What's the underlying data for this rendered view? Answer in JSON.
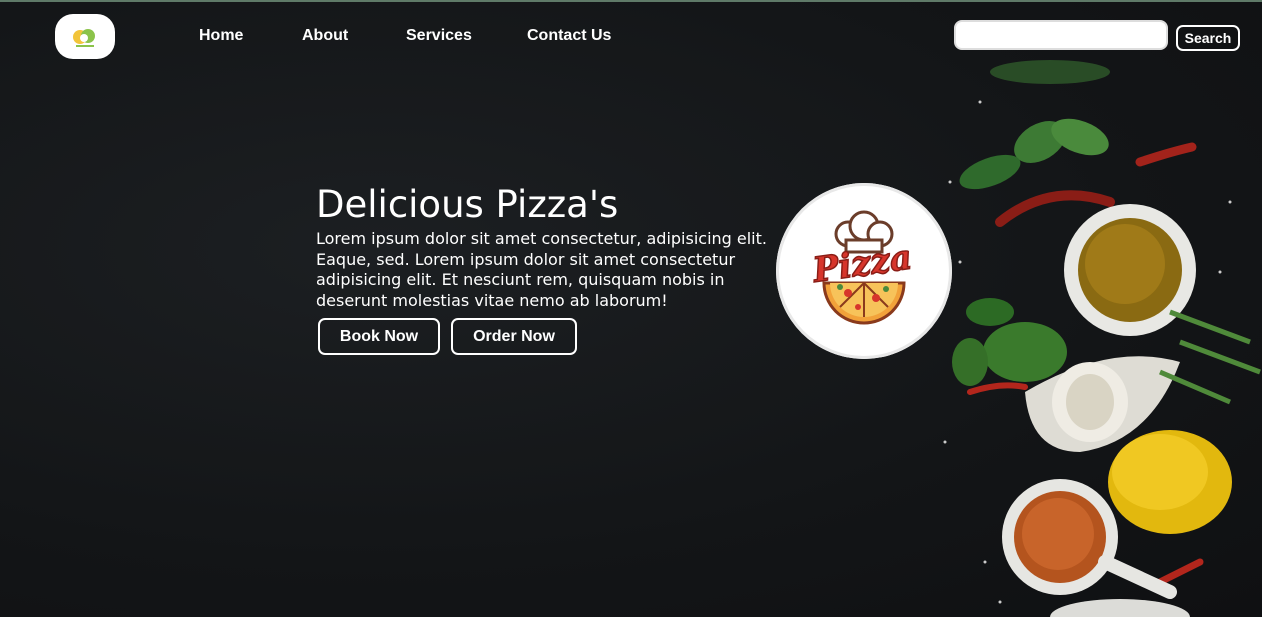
{
  "nav": {
    "links": [
      "Home",
      "About",
      "Services",
      "Contact Us"
    ],
    "search_placeholder": "",
    "search_label": "Search"
  },
  "hero": {
    "title": "Delicious Pizza's",
    "text": "Lorem ipsum dolor sit amet consectetur, adipisicing elit. Eaque, sed. Lorem ipsum dolor sit amet consectetur adipisicing elit. Et nesciunt rem, quisquam nobis in deserunt molestias vitae nemo ab laborum!",
    "book_label": "Book Now",
    "order_label": "Order Now"
  },
  "brand": {
    "logo_text": "Pizza"
  },
  "colors": {
    "background": "#141618",
    "accent_red": "#d7352b",
    "pizza_orange": "#f2a23a"
  }
}
